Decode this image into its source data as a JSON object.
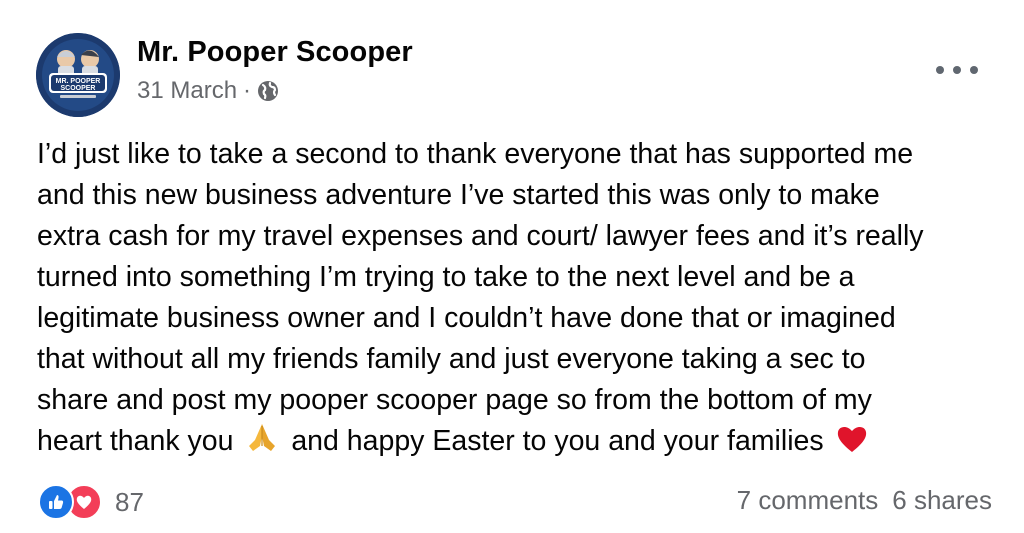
{
  "post": {
    "author": "Mr. Pooper Scooper",
    "date": "31 March",
    "separator": "·",
    "privacy_icon": "globe-icon",
    "more_icon": "more-options-icon",
    "avatar_text": [
      "MR. POOPER",
      "SCOOPER"
    ],
    "body_lines": [
      "I’d just like to take a second to thank everyone that has supported me",
      "and this new business adventure I’ve started this was only to make",
      "extra cash for my travel expenses and court/ lawyer fees and it’s really",
      "turned into something I’m trying to take to the next level and be a",
      "legitimate business owner and I couldn’t have done that or imagined",
      "that without all my friends family and just everyone taking a sec to",
      "share and post my pooper scooper page so from the bottom of my"
    ],
    "last_line": {
      "before_emoji": "heart thank you",
      "emoji_1": "folded-hands-emoji",
      "middle": "and happy Easter to you and your families",
      "emoji_2": "red-heart-emoji"
    }
  },
  "footer": {
    "reaction_icons": [
      "like-icon",
      "love-icon"
    ],
    "reaction_count": "87",
    "comments": "7 comments",
    "shares": "6 shares"
  },
  "colors": {
    "text": "#050505",
    "secondary": "#65676b",
    "like": "#1b74e4",
    "love": "#f33e58",
    "avatar_bg": "#1c3a6e"
  }
}
